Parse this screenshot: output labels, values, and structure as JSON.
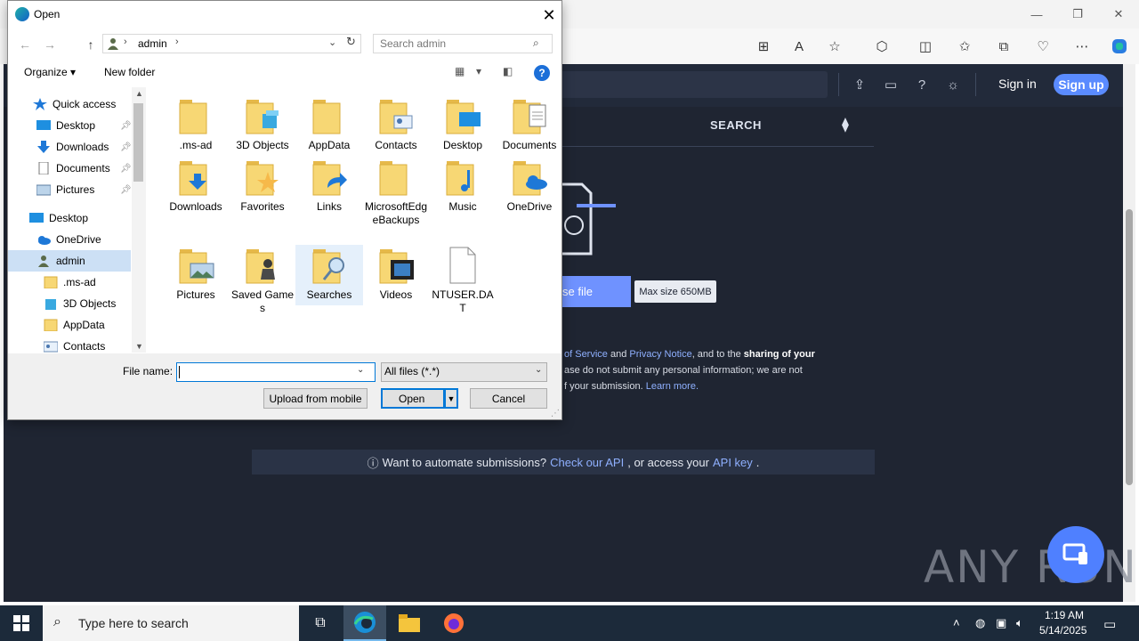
{
  "dialog": {
    "title": "Open",
    "address_path": "admin",
    "search_placeholder": "Search admin",
    "organize_label": "Organize ▾",
    "new_folder_label": "New folder",
    "help_glyph": "?",
    "nav_items": [
      {
        "label": "Quick access",
        "icon": "star-icon"
      },
      {
        "label": "Desktop",
        "icon": "desktop-icon",
        "pinned": true
      },
      {
        "label": "Downloads",
        "icon": "download-icon",
        "pinned": true
      },
      {
        "label": "Documents",
        "icon": "documents-icon",
        "pinned": true
      },
      {
        "label": "Pictures",
        "icon": "pictures-icon",
        "pinned": true
      },
      {
        "label": "Desktop",
        "icon": "desktop-icon"
      },
      {
        "label": "OneDrive",
        "icon": "cloud-icon"
      },
      {
        "label": "admin",
        "icon": "user-icon",
        "selected": true
      },
      {
        "label": ".ms-ad",
        "icon": "folder-icon"
      },
      {
        "label": "3D Objects",
        "icon": "cube-icon"
      },
      {
        "label": "AppData",
        "icon": "folder-icon"
      },
      {
        "label": "Contacts",
        "icon": "contacts-icon"
      }
    ],
    "files": [
      {
        "name": ".ms-ad",
        "icon": "folder-icon"
      },
      {
        "name": "3D Objects",
        "icon": "folder-3d-objects-icon"
      },
      {
        "name": "AppData",
        "icon": "folder-icon"
      },
      {
        "name": "Contacts",
        "icon": "folder-contacts-icon"
      },
      {
        "name": "Desktop",
        "icon": "folder-desktop-icon"
      },
      {
        "name": "Documents",
        "icon": "folder-documents-icon"
      },
      {
        "name": "Downloads",
        "icon": "folder-downloads-icon"
      },
      {
        "name": "Favorites",
        "icon": "folder-favorites-icon"
      },
      {
        "name": "Links",
        "icon": "folder-links-icon"
      },
      {
        "name": "MicrosoftEdgeBackups",
        "icon": "folder-icon"
      },
      {
        "name": "Music",
        "icon": "folder-music-icon"
      },
      {
        "name": "OneDrive",
        "icon": "folder-onedrive-icon"
      },
      {
        "name": "Pictures",
        "icon": "folder-pictures-icon"
      },
      {
        "name": "Saved Games",
        "icon": "folder-saved-games-icon"
      },
      {
        "name": "Searches",
        "icon": "folder-searches-icon",
        "selected": true
      },
      {
        "name": "Videos",
        "icon": "folder-videos-icon"
      },
      {
        "name": "NTUSER.DAT",
        "icon": "file-icon"
      }
    ],
    "file_name_label": "File name:",
    "file_name_value": "",
    "filter_value": "All files (*.*)",
    "upload_mobile_label": "Upload from mobile",
    "open_label": "Open",
    "cancel_label": "Cancel"
  },
  "web": {
    "tab_search": "SEARCH",
    "signin": "Sign in",
    "signup": "Sign up",
    "choose_file_fragment": "se file",
    "max_size": "Max size 650MB",
    "terms": {
      "l1_link1": "of Service",
      "l1_and": " and ",
      "l1_link2": "Privacy Notice",
      "l1_rest": ", and to the ",
      "l1_bold": "sharing of your",
      "l2": "ase do not submit any personal information; we are not",
      "l3_pre": "f your submission. ",
      "l3_link": "Learn more."
    },
    "api_bar": {
      "text1": "Want to automate submissions?",
      "link1": "Check our API",
      "text2": ", or access your",
      "link2": "API key",
      "text3": "."
    },
    "watermark": "ANY RUN"
  },
  "taskbar": {
    "search_placeholder": "Type here to search",
    "time": "1:19 AM",
    "date": "5/14/2025"
  },
  "colors": {
    "accent": "#0078d7",
    "web_bg": "#1f2532",
    "link": "#8fb0ff",
    "signup": "#5a8bff",
    "taskbar": "#1c2a3a",
    "folder": "#f7d774"
  }
}
